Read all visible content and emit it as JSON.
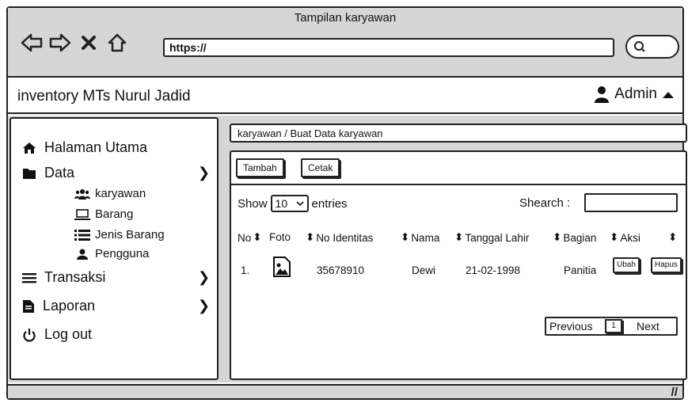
{
  "window": {
    "title": "Tampilan karyawan",
    "url": "https://"
  },
  "app": {
    "title": "inventory MTs Nurul Jadid",
    "user": "Admin"
  },
  "sidebar": {
    "items": [
      {
        "label": "Halaman Utama",
        "icon": "home-icon"
      },
      {
        "label": "Data",
        "icon": "folder-icon"
      },
      {
        "label": "Transaksi",
        "icon": "list-icon"
      },
      {
        "label": "Laporan",
        "icon": "document-icon"
      },
      {
        "label": "Log out",
        "icon": "power-icon"
      }
    ],
    "sub_items": [
      {
        "label": "karyawan",
        "icon": "users-icon"
      },
      {
        "label": "Barang",
        "icon": "laptop-icon"
      },
      {
        "label": "Jenis Barang",
        "icon": "list-icon"
      },
      {
        "label": "Pengguna",
        "icon": "user-icon"
      }
    ]
  },
  "breadcrumb": "karyawan / Buat Data karyawan",
  "toolbar": {
    "add_label": "Tambah",
    "print_label": "Cetak"
  },
  "table_controls": {
    "show_label": "Show",
    "entries_value": "10",
    "entries_label": "entries",
    "search_label": "Shearch :"
  },
  "table": {
    "columns": [
      "No",
      "Foto",
      "No Identitas",
      "Nama",
      "Tanggal Lahir",
      "Bagian",
      "Aksi"
    ],
    "rows": [
      {
        "no": "1.",
        "no_identitas": "35678910",
        "nama": "Dewi",
        "tanggal_lahir": "21-02-1998",
        "bagian": "Panitia",
        "edit_label": "Ubah",
        "delete_label": "Hapus"
      }
    ]
  },
  "pagination": {
    "previous": "Previous",
    "page": "1",
    "next": "Next"
  }
}
